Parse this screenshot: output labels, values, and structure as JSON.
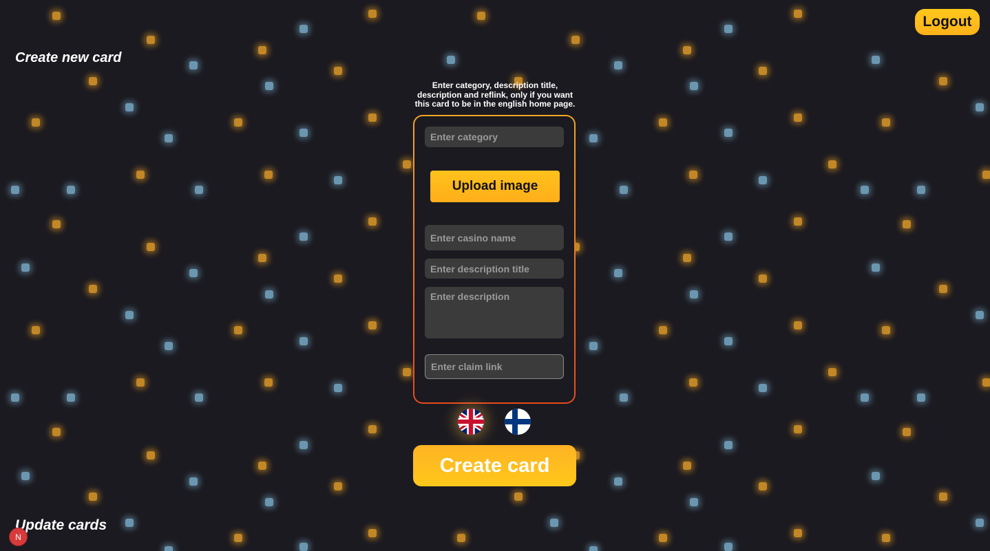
{
  "header": {
    "logout_label": "Logout"
  },
  "create_section": {
    "title": "Create new card",
    "instructions": "Enter category, description title, description and reflink, only if you want this card to be in the english home page.",
    "form": {
      "category_placeholder": "Enter category",
      "upload_label": "Upload image",
      "casino_name_placeholder": "Enter casino name",
      "description_title_placeholder": "Enter description title",
      "description_placeholder": "Enter description",
      "claim_link_placeholder": "Enter claim link"
    },
    "languages": [
      {
        "name": "english",
        "icon": "uk-flag-icon"
      },
      {
        "name": "finnish",
        "icon": "finland-flag-icon"
      }
    ],
    "create_label": "Create card"
  },
  "update_section": {
    "title": "Update cards"
  },
  "badge": {
    "letter": "N"
  },
  "colors": {
    "background": "#1b1a20",
    "accent": "#ffb81a",
    "field_bg": "#3b3b3b",
    "border_top": "#f5a623",
    "border_bottom": "#e84a1f",
    "dot_orange": "#e09a28",
    "dot_blue": "#7fb6d4"
  }
}
